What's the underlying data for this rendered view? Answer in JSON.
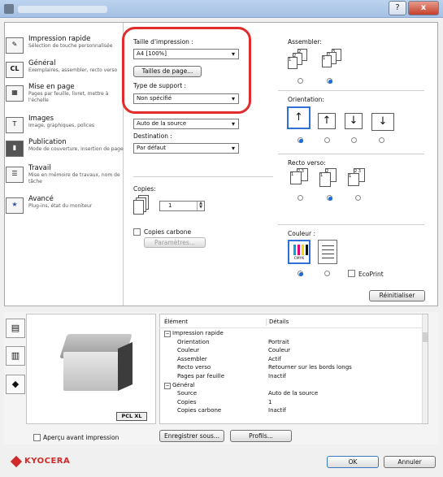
{
  "window": {
    "help_label": "?",
    "minimize_label": "–",
    "close_label": "x"
  },
  "sidebar": {
    "items": [
      {
        "title": "Impression rapide",
        "sub": "Sélection de touche personnalisée"
      },
      {
        "title": "Général",
        "sub": "Exemplaires, assembler, recto verso"
      },
      {
        "title": "Mise en page",
        "sub": "Pages par feuille, livret, mettre à l'échelle"
      },
      {
        "title": "Images",
        "sub": "Image, graphiques, polices"
      },
      {
        "title": "Publication",
        "sub": "Mode de couverture, insertion de page"
      },
      {
        "title": "Travail",
        "sub": "Mise en mémoire de travaux, nom de tâche"
      },
      {
        "title": "Avancé",
        "sub": "Plug-ins, état du moniteur"
      }
    ]
  },
  "form": {
    "print_size_label": "Taille d'impression :",
    "print_size_value": "A4 [100%]",
    "page_sizes_button": "Tailles de page...",
    "media_type_label": "Type de support :",
    "media_type_value": "Non spécifié",
    "source_value": "Auto de la source",
    "destination_label": "Destination :",
    "destination_value": "Par défaut",
    "copies_label": "Copies:",
    "copies_value": "1",
    "carbon_label": "Copies carbone",
    "parameters_button": "Paramètres..."
  },
  "right": {
    "collate_label": "Assembler:",
    "orientation_label": "Orientation:",
    "duplex_label": "Recto verso:",
    "color_label": "Couleur :",
    "ecoprint_label": "EcoPrint",
    "cmyk_label": "CMYK",
    "reset_button": "Réinitialiser"
  },
  "bottom": {
    "pcl_badge": "PCL XL",
    "preview_label": "Aperçu avant impression",
    "save_button": "Enregistrer sous...",
    "profiles_button": "Profils...",
    "table": {
      "headers": [
        "Élément",
        "Détails"
      ],
      "rows": [
        {
          "item": "Impression rapide",
          "detail": "",
          "group": true
        },
        {
          "item": "Orientation",
          "detail": "Portrait",
          "group": false
        },
        {
          "item": "Couleur",
          "detail": "Couleur",
          "group": false
        },
        {
          "item": "Assembler",
          "detail": "Actif",
          "group": false
        },
        {
          "item": "Recto verso",
          "detail": "Retourner sur les bords longs",
          "group": false
        },
        {
          "item": "Pages par feuille",
          "detail": "Inactif",
          "group": false
        },
        {
          "item": "Général",
          "detail": "",
          "group": true
        },
        {
          "item": "Source",
          "detail": "Auto de la source",
          "group": false
        },
        {
          "item": "Copies",
          "detail": "1",
          "group": false
        },
        {
          "item": "Copies carbone",
          "detail": "Inactif",
          "group": false
        }
      ]
    }
  },
  "footer": {
    "brand": "KYOCERA",
    "ok_button": "OK",
    "cancel_button": "Annuler"
  },
  "colors": {
    "highlight": "#e22b2b",
    "accent": "#2f6fd8",
    "brand": "#d22a2a"
  }
}
